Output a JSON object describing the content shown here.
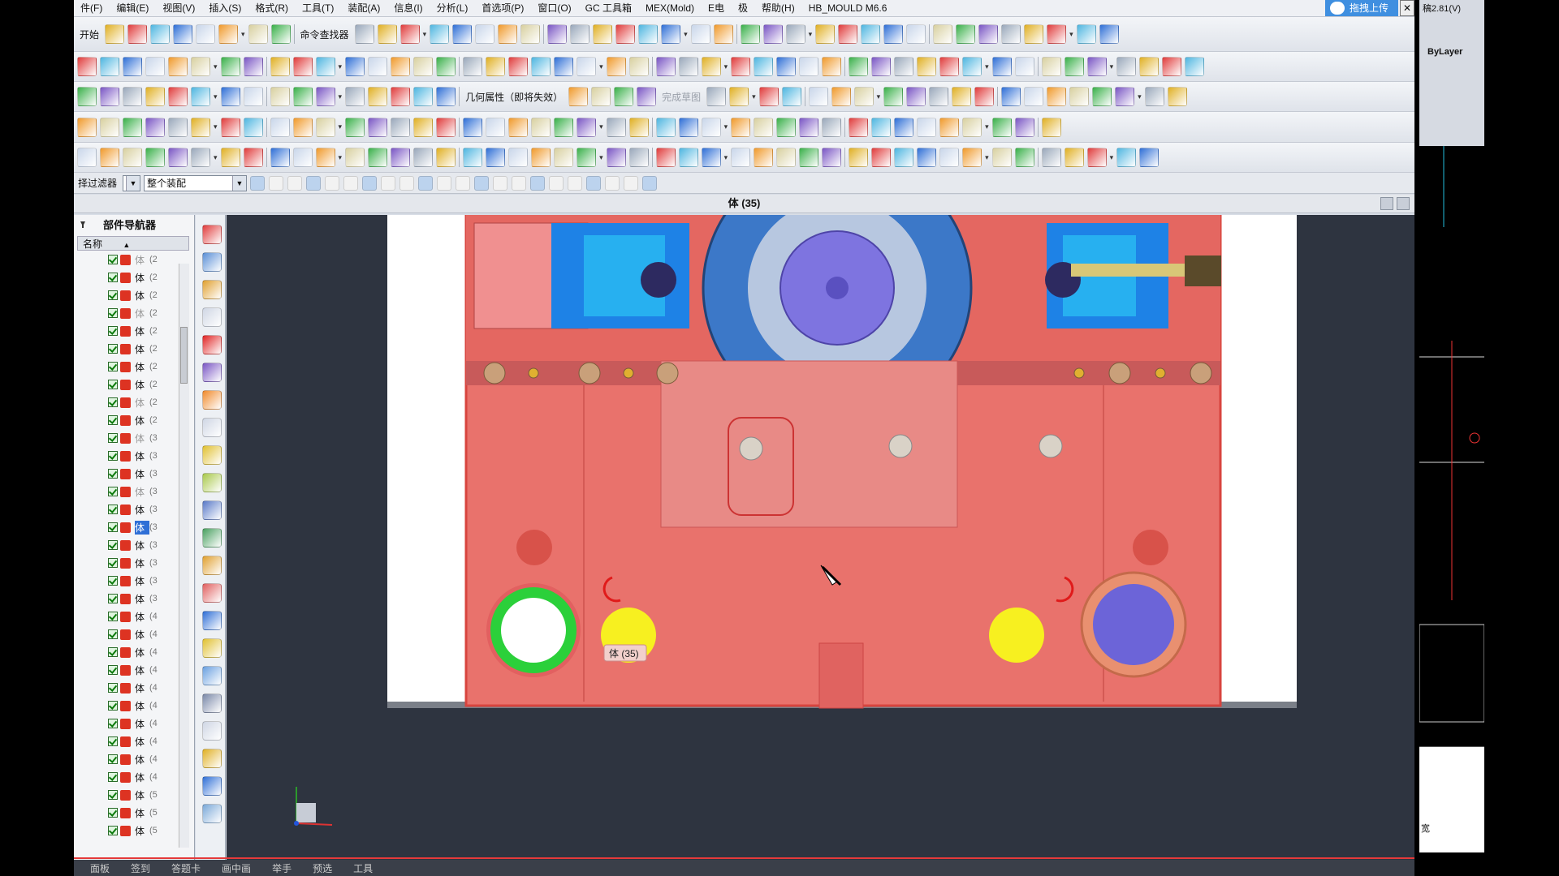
{
  "menubar": {
    "items": [
      "件(F)",
      "编辑(E)",
      "视图(V)",
      "插入(S)",
      "格式(R)",
      "工具(T)",
      "装配(A)",
      "信息(I)",
      "分析(L)",
      "首选项(P)",
      "窗口(O)",
      "GC 工具箱",
      "MEX(Mold)",
      "E电",
      "极",
      "帮助(H)",
      "HB_MOULD M6.6"
    ],
    "upload_label": "拖拽上传",
    "version_text": "稿2.81(V)"
  },
  "toolbar1": {
    "start_label": "开始",
    "command_finder_label": "命令查找器"
  },
  "toolbar3": {
    "geom_props_label": "几何属性（即将失效）",
    "finish_sketch_label": "完成草图"
  },
  "filterbar": {
    "filter_label": "择过滤器",
    "scope_value": "整个装配"
  },
  "view_title": "体 (35)",
  "navigator": {
    "title": "部件导航器",
    "column_name": "名称",
    "rows": [
      {
        "name": "体",
        "num": "(2"
      },
      {
        "name": "体",
        "num": "(2"
      },
      {
        "name": "体",
        "num": "(2"
      },
      {
        "name": "体",
        "num": "(2"
      },
      {
        "name": "体",
        "num": "(2"
      },
      {
        "name": "体",
        "num": "(2"
      },
      {
        "name": "体",
        "num": "(2"
      },
      {
        "name": "体",
        "num": "(2"
      },
      {
        "name": "体",
        "num": "(2"
      },
      {
        "name": "体",
        "num": "(2"
      },
      {
        "name": "体",
        "num": "(3"
      },
      {
        "name": "体",
        "num": "(3"
      },
      {
        "name": "体",
        "num": "(3"
      },
      {
        "name": "体",
        "num": "(3"
      },
      {
        "name": "体",
        "num": "(3"
      },
      {
        "name": "体",
        "num": "(3"
      },
      {
        "name": "体",
        "num": "(3"
      },
      {
        "name": "体",
        "num": "(3"
      },
      {
        "name": "体",
        "num": "(3"
      },
      {
        "name": "体",
        "num": "(3"
      },
      {
        "name": "体",
        "num": "(4"
      },
      {
        "name": "体",
        "num": "(4"
      },
      {
        "name": "体",
        "num": "(4"
      },
      {
        "name": "体",
        "num": "(4"
      },
      {
        "name": "体",
        "num": "(4"
      },
      {
        "name": "体",
        "num": "(4"
      },
      {
        "name": "体",
        "num": "(4"
      },
      {
        "name": "体",
        "num": "(4"
      },
      {
        "name": "体",
        "num": "(4"
      },
      {
        "name": "体",
        "num": "(4"
      },
      {
        "name": "体",
        "num": "(5"
      },
      {
        "name": "体",
        "num": "(5"
      },
      {
        "name": "体",
        "num": "(5"
      }
    ],
    "selected_index": 15,
    "dim_indices": [
      0,
      3,
      8,
      10,
      13
    ]
  },
  "tooltip": "体 (35)",
  "rightpanel": {
    "layer_label": "ByLayer",
    "bottom_label": "宽"
  },
  "statusbar": {
    "tabs": [
      "面板",
      "签到",
      "答题卡",
      "画中画",
      "举手",
      "预选",
      "工具"
    ]
  },
  "colors": {
    "accent": "#3f8fe0",
    "plate": "#e9726c",
    "steel": "#3c78c8",
    "selected_rows": "#2f6fd6"
  },
  "icons": [
    "save-icon",
    "undo-icon",
    "redo-icon",
    "binoculars-icon",
    "cursor-icon",
    "pin-icon"
  ]
}
